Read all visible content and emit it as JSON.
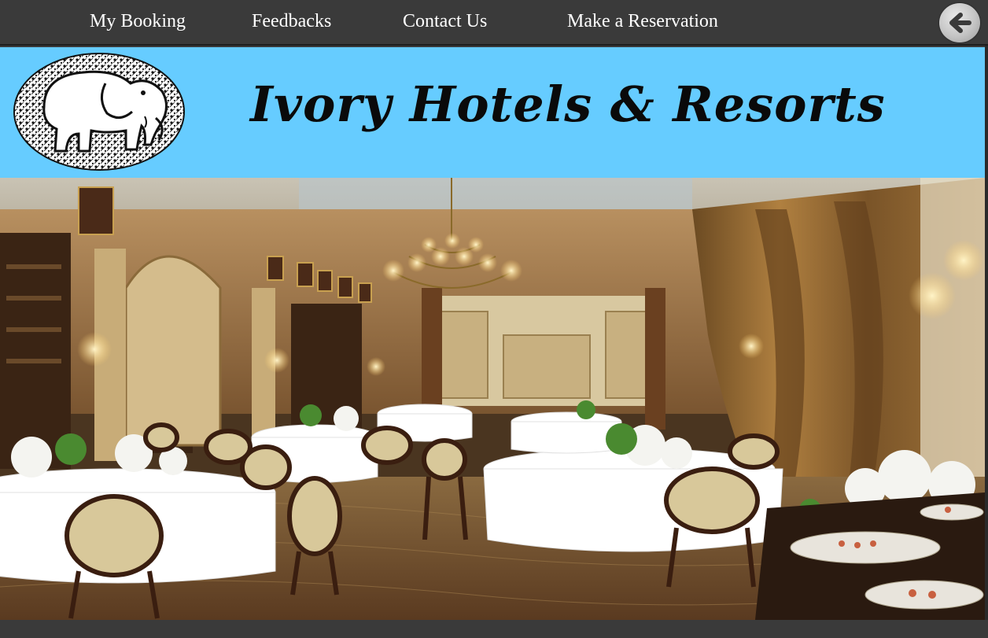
{
  "nav": {
    "items": [
      {
        "label": "My Booking"
      },
      {
        "label": "Feedbacks"
      },
      {
        "label": "Contact Us"
      },
      {
        "label": "Make a Reservation"
      }
    ],
    "back_icon": "arrow-left-icon"
  },
  "header": {
    "brand_title": "Ivory Hotels & Resorts",
    "logo_icon": "elephant-logo",
    "background_color": "#66ccff"
  },
  "hero": {
    "image_subject": "hotel-restaurant-dining-room"
  },
  "colors": {
    "navbar": "#3a3a3a",
    "nav_text": "#ffffff",
    "banner": "#66ccff"
  }
}
